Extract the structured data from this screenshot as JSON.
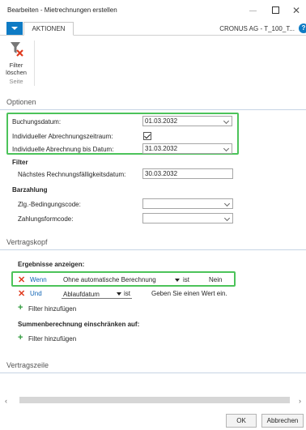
{
  "window": {
    "title": "Bearbeiten - Mietrechnungen erstellen",
    "minimize_icon": "minimize-icon",
    "maximize_icon": "maximize-icon",
    "close_icon": "close-icon",
    "close_glyph": "✕"
  },
  "ribbon": {
    "tab_label": "AKTIONEN",
    "company": "CRONUS AG - T_100_T...",
    "help_glyph": "?",
    "filter_button_line1": "Filter",
    "filter_button_line2": "löschen",
    "group_label": "Seite"
  },
  "optionen": {
    "header": "Optionen",
    "buchungsdatum_label": "Buchungsdatum:",
    "buchungsdatum_value": "01.03.2032",
    "individueller_zeitraum_label": "Individueller Abrechnungszeitraum:",
    "individueller_zeitraum_checked": true,
    "individuelle_bis_label": "Individuelle Abrechnung bis Datum:",
    "individuelle_bis_value": "31.03.2032",
    "filter_heading": "Filter",
    "naechstes_label": "Nächstes Rechnungsfälligkeitsdatum:",
    "naechstes_value": "30.03.2032",
    "barzahlung_heading": "Barzahlung",
    "zlg_label": "Zlg.-Bedingungscode:",
    "zlg_value": "",
    "zahlungsform_label": "Zahlungsformcode:",
    "zahlungsform_value": ""
  },
  "vertragskopf": {
    "header": "Vertragskopf",
    "ergebnisse_heading": "Ergebnisse anzeigen:",
    "row1": {
      "op": "Wenn",
      "field": "Ohne automatische Berechnung",
      "cmp": "ist",
      "value": "Nein"
    },
    "row2": {
      "op": "Und",
      "field": "Ablaufdatum",
      "cmp": "ist",
      "value": "Geben Sie einen Wert ein."
    },
    "add_filter_1": "Filter hinzufügen",
    "summen_heading": "Summenberechnung einschränken auf:",
    "add_filter_2": "Filter hinzufügen"
  },
  "vertragszeile": {
    "header": "Vertragszeile"
  },
  "footer": {
    "ok_label": "OK",
    "cancel_label": "Abbrechen"
  },
  "colors": {
    "accent": "#0e7bc4",
    "highlight": "#4cc35a",
    "delete_red": "#e03a1e",
    "add_green": "#2e9a3b"
  }
}
